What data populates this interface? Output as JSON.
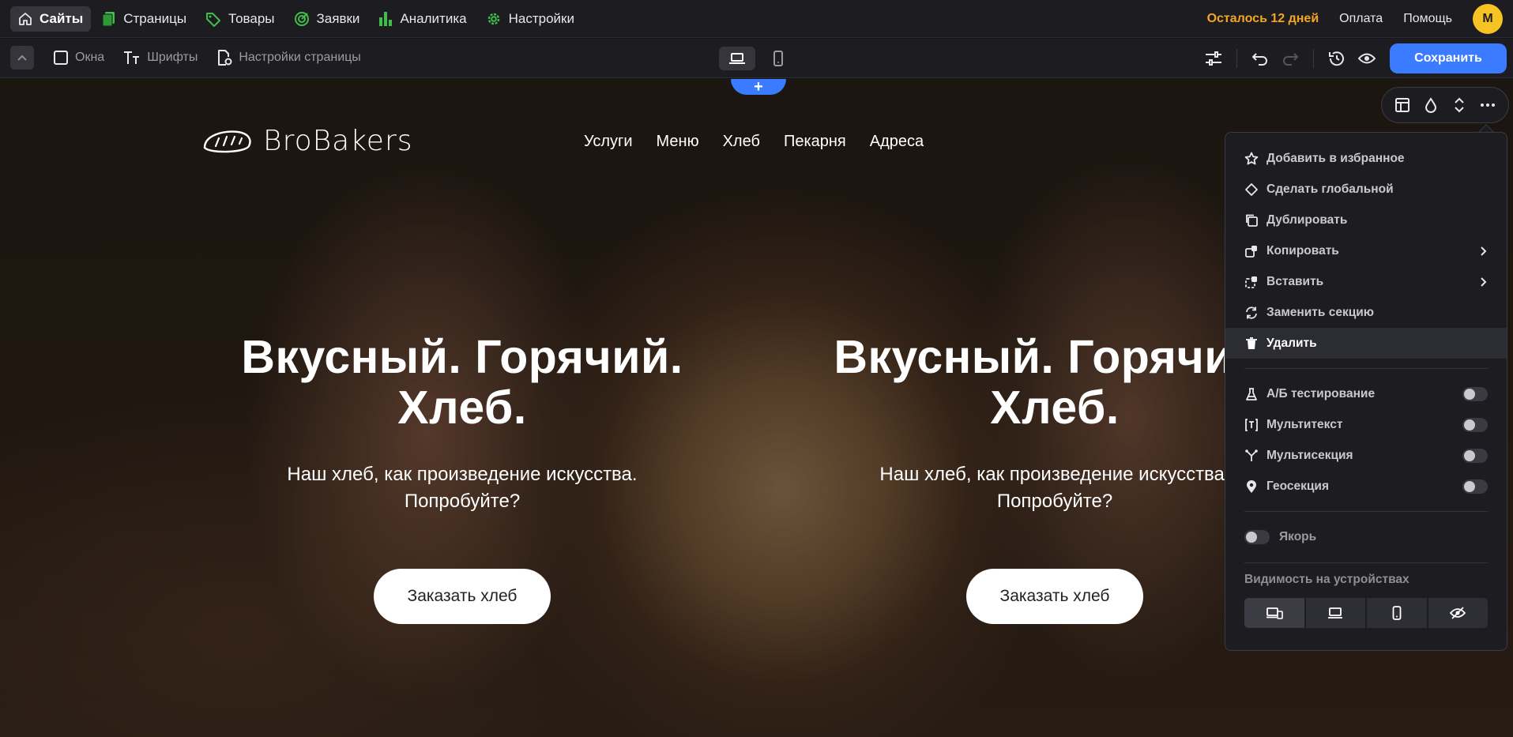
{
  "topnav": {
    "items": [
      {
        "label": "Сайты",
        "icon": "home-icon"
      },
      {
        "label": "Страницы",
        "icon": "pages-icon"
      },
      {
        "label": "Товары",
        "icon": "tag-icon"
      },
      {
        "label": "Заявки",
        "icon": "target-icon"
      },
      {
        "label": "Аналитика",
        "icon": "bar-chart-icon"
      },
      {
        "label": "Настройки",
        "icon": "gear-icon"
      }
    ],
    "trial_text": "Осталось 12 дней",
    "payment_label": "Оплата",
    "help_label": "Помощь",
    "avatar_letter": "M",
    "colors": {
      "trial": "#f5a524",
      "avatar": "#f7c324",
      "nav_icon": "#3fbf4a"
    }
  },
  "toolbar": {
    "windows_label": "Окна",
    "fonts_label": "Шрифты",
    "page_settings_label": "Настройки страницы",
    "device_modes": [
      "desktop-icon",
      "mobile-icon"
    ],
    "save_label": "Сохранить",
    "colors": {
      "save": "#3a7bff"
    }
  },
  "site": {
    "add_section_symbol": "+",
    "logo_text": "BroBakers",
    "nav": [
      "Услуги",
      "Меню",
      "Хлеб",
      "Пекарня",
      "Адреса"
    ],
    "hero_title_line1": "Вкусный. Горячий.",
    "hero_title_line2": "Хлеб.",
    "hero_sub_line1": "Наш хлеб, как произведение искусства.",
    "hero_sub_line2": "Попробуйте?",
    "hero_button": "Заказать хлеб"
  },
  "section_tools": [
    "layout-icon",
    "drop-icon",
    "resize-vertical-icon",
    "more-icon"
  ],
  "context_menu": {
    "items": [
      {
        "label": "Добавить в избранное",
        "icon": "star-icon"
      },
      {
        "label": "Сделать глобальной",
        "icon": "diamond-icon"
      },
      {
        "label": "Дублировать",
        "icon": "duplicate-icon"
      },
      {
        "label": "Копировать",
        "icon": "copy-icon",
        "submenu": true
      },
      {
        "label": "Вставить",
        "icon": "paste-icon",
        "submenu": true
      },
      {
        "label": "Заменить секцию",
        "icon": "replace-icon"
      },
      {
        "label": "Удалить",
        "icon": "trash-icon",
        "highlighted": true
      }
    ],
    "toggles": [
      {
        "label": "А/Б тестирование",
        "icon": "flask-icon",
        "on": false
      },
      {
        "label": "Мультитекст",
        "icon": "multitext-icon",
        "on": false
      },
      {
        "label": "Мультисекция",
        "icon": "branch-icon",
        "on": false
      },
      {
        "label": "Геосекция",
        "icon": "location-pin-icon",
        "on": false
      }
    ],
    "anchor_label": "Якорь",
    "anchor_on": false,
    "visibility_title": "Видимость на устройствах",
    "visibility_options": [
      {
        "icon": "all-devices-icon",
        "selected": true
      },
      {
        "icon": "desktop-icon",
        "selected": false
      },
      {
        "icon": "mobile-icon",
        "selected": false
      },
      {
        "icon": "eye-off-icon",
        "selected": false
      }
    ]
  }
}
